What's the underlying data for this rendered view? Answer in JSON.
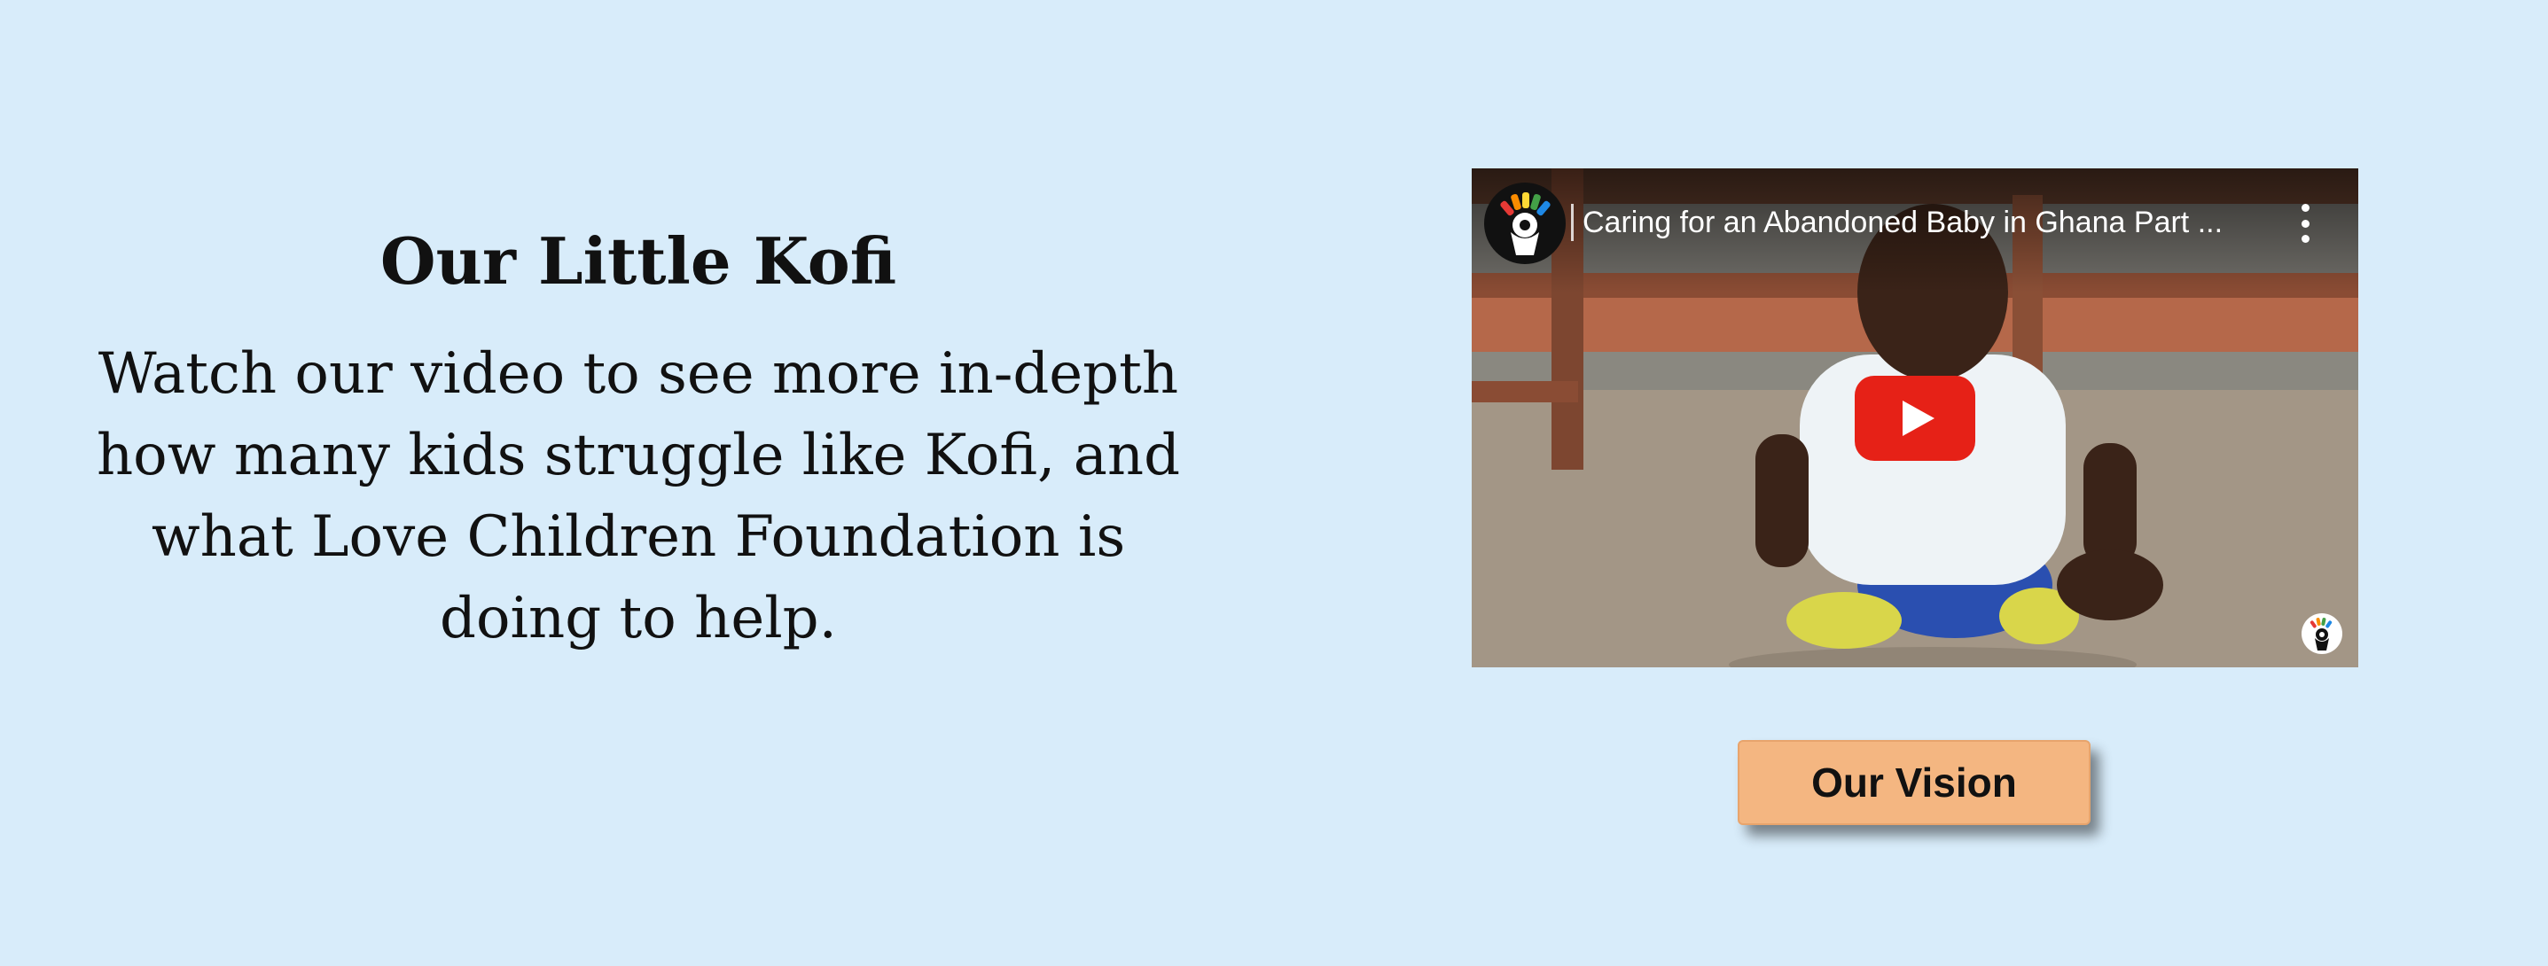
{
  "section": {
    "title": "Our Little Kofi",
    "body": "Watch our video to see more in-depth how many kids struggle like Kofi, and what Love Children Foundation is doing to help."
  },
  "video": {
    "title": "Caring for an Abandoned Baby in Ghana Part ...",
    "channel_icon": "channel-logo-icon",
    "menu_icon": "more-vertical-icon",
    "play_icon": "youtube-play-icon",
    "watermark_icon": "channel-watermark-icon"
  },
  "cta": {
    "label": "Our Vision"
  },
  "colors": {
    "background": "#d8ecfa",
    "button": "#f4b681",
    "play_red": "#e62117",
    "logo_segments": [
      "#e53935",
      "#fb8c00",
      "#fdd835",
      "#43a047",
      "#1e88e5",
      "#8e24aa"
    ]
  }
}
